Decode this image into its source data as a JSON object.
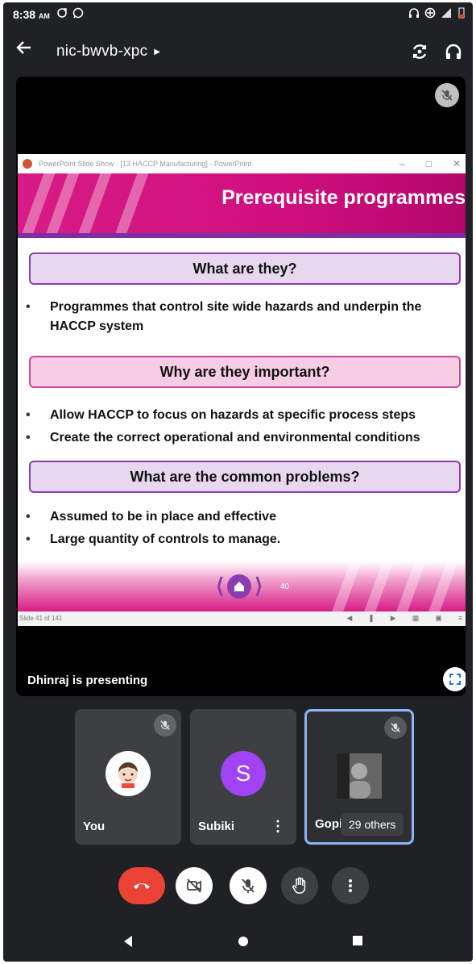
{
  "status_bar": {
    "time": "8:38",
    "ampm": "AM"
  },
  "header": {
    "title": "nic-bwvb-xpc"
  },
  "presentation": {
    "window_title": "PowerPoint Slide Show - [13 HACCP Manufacturing] - PowerPoint",
    "slide_title": "Prerequisite programmes",
    "sections": [
      {
        "heading": "What are they?",
        "bullets": [
          "Programmes that control site wide hazards and underpin the HACCP system"
        ]
      },
      {
        "heading": "Why are they important?",
        "bullets": [
          "Allow HACCP to focus on hazards at specific process steps",
          "Create the correct operational and environmental conditions"
        ]
      },
      {
        "heading": "What are the common problems?",
        "bullets": [
          "Assumed to be in place and effective",
          "Large quantity of controls to manage."
        ]
      }
    ],
    "slide_number": "40",
    "status_text": "Slide 41 of 141",
    "presenter_text": "Dhinraj is presenting"
  },
  "participants": [
    {
      "name": "You",
      "avatar": "cartoon-avatar"
    },
    {
      "name": "Subiki",
      "initial": "S",
      "color": "#a142f4"
    },
    {
      "name": "Gopi",
      "others": "29 others"
    }
  ],
  "colors": {
    "end_call": "#ea4335",
    "slide_accent": "#d81b86",
    "slide_purple": "#8a3db0",
    "active_border": "#8ab4f8"
  }
}
